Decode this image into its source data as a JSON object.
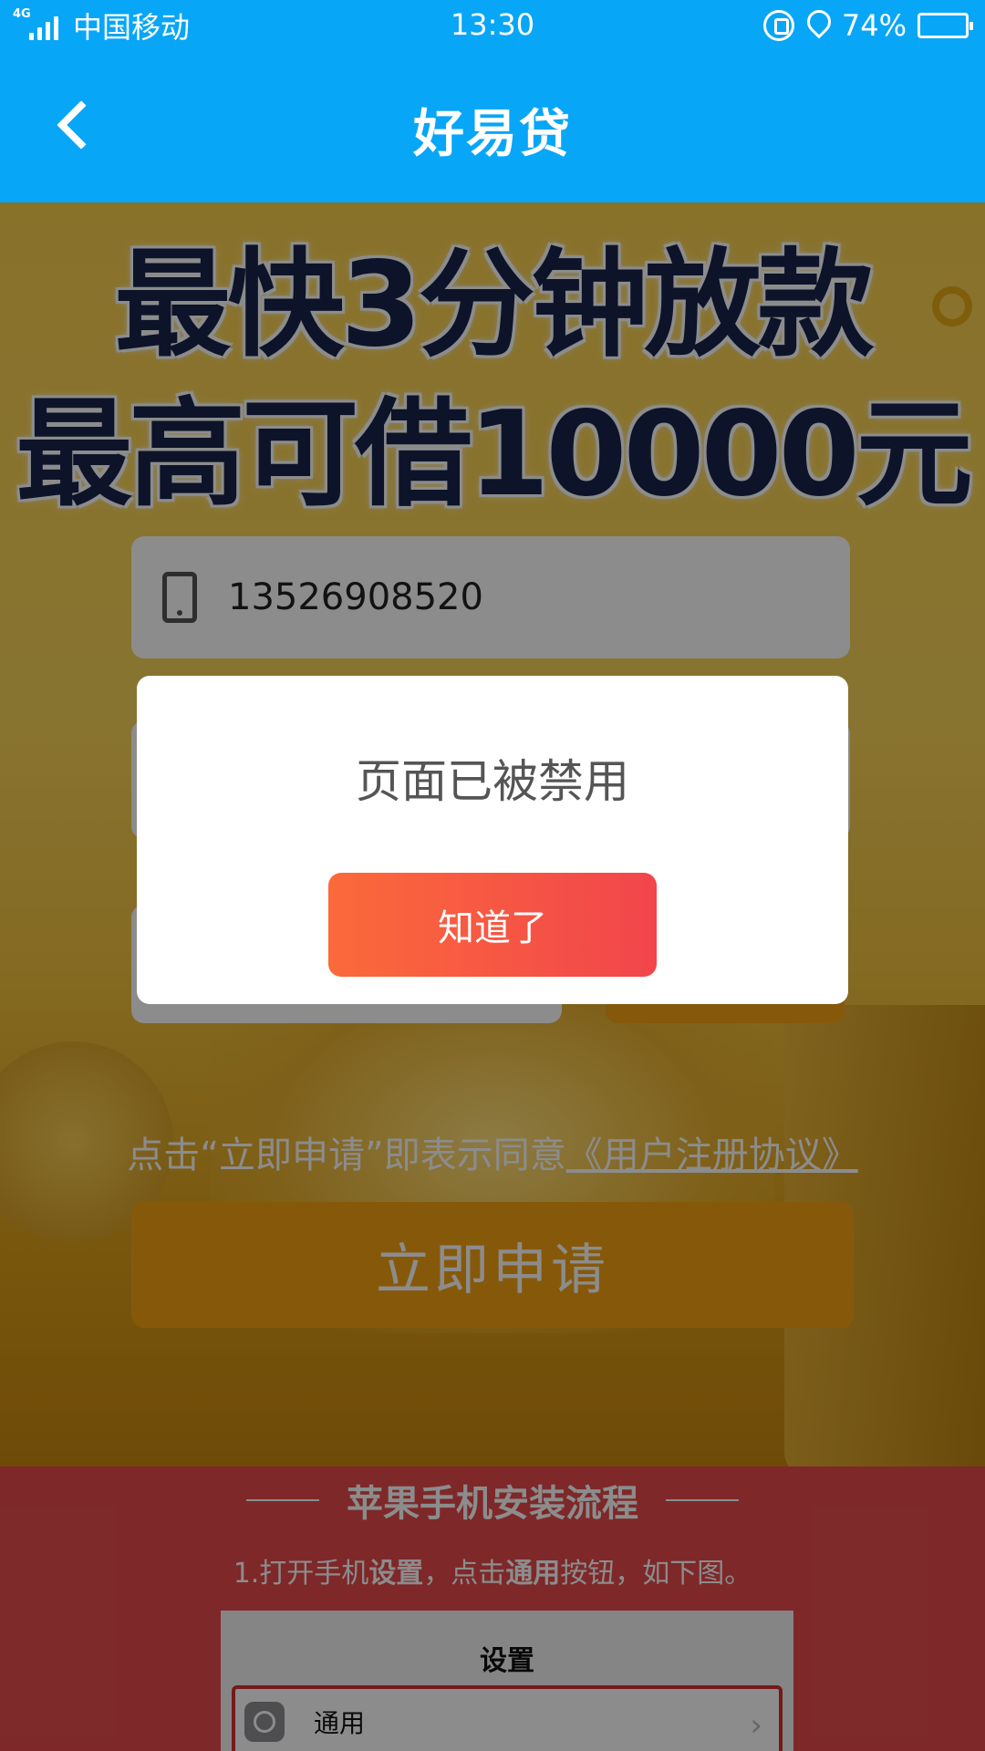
{
  "status_bar": {
    "network": "4G",
    "carrier": "中国移动",
    "time": "13:30",
    "battery": "74%",
    "battery_level": 0.74,
    "icons": [
      "signal-icon",
      "rotation-lock-icon",
      "location-icon",
      "battery-icon"
    ]
  },
  "header": {
    "title": "好易贷",
    "back_icon": "chevron-left-icon"
  },
  "hero": {
    "line1": "最快3分钟放款",
    "line2": "最高可借10000元"
  },
  "form": {
    "phone_value": "13526908520",
    "phone_icon": "phone-icon"
  },
  "agreement": {
    "text": "点击“立即申请”即表示同意",
    "link": "《用户注册协议》"
  },
  "apply_button": "立即申请",
  "install_guide": {
    "title": "苹果手机安装流程",
    "step1_prefix": "1.打开手机",
    "step1_bold1": "设置",
    "step1_mid": "，点击",
    "step1_bold2": "通用",
    "step1_suffix": "按钮，如下图。",
    "screenshot_title": "设置",
    "screenshot_row": "通用"
  },
  "dialog": {
    "message": "页面已被禁用",
    "ok_button": "知道了"
  },
  "colors": {
    "header_blue": "#08a6f7",
    "accent_orange": "#f4a313",
    "dialog_button_start": "#fb6a3a",
    "dialog_button_end": "#f2454c",
    "lower_red": "#e54a4c"
  }
}
